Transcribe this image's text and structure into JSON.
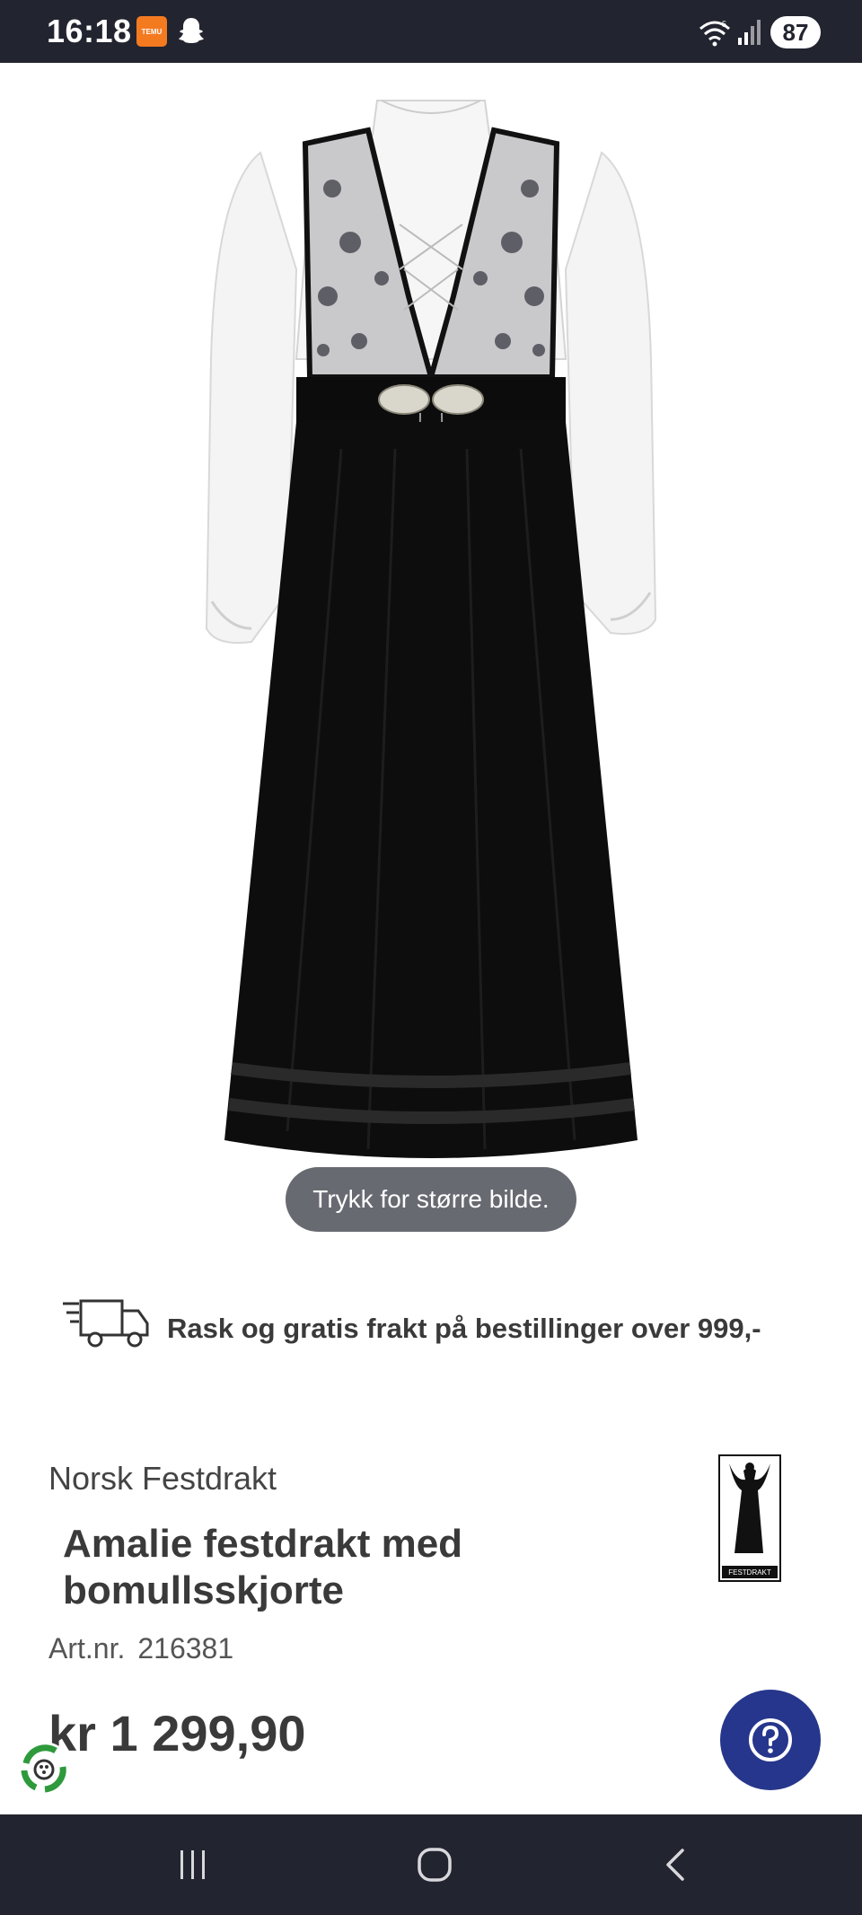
{
  "status_bar": {
    "time": "16:18",
    "battery": "87",
    "temu_label": "TEMU",
    "icons": [
      "temu-app-icon",
      "snapchat-icon",
      "wifi-icon",
      "signal-icon"
    ]
  },
  "product_image": {
    "hint": "Trykk for større bilde."
  },
  "shipping": {
    "text": "Rask og gratis frakt på bestillinger over 999,-"
  },
  "product": {
    "brand": "Norsk Festdrakt",
    "logo_text": "FESTDRAKT",
    "title": "Amalie festdrakt med bomullsskjorte",
    "art_label": "Art.nr.",
    "art_number": "216381",
    "price": "kr 1 299,90"
  },
  "colors": {
    "status_bar": "#222430",
    "help_button": "#26368c",
    "text": "#3a3a3a",
    "recycle_green": "#2e9a3c"
  },
  "nav": {
    "icons": [
      "recent-apps-icon",
      "home-icon",
      "back-icon"
    ]
  }
}
